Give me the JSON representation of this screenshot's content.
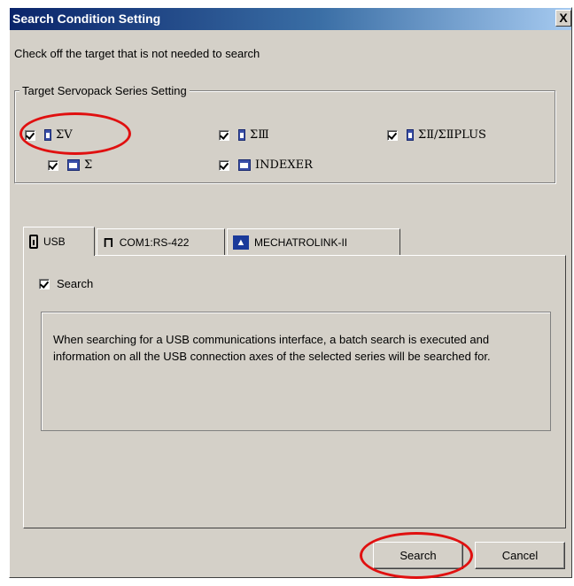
{
  "window": {
    "title": "Search Condition Setting",
    "close_label": "X"
  },
  "instruction": "Check off the target that is not needed to search",
  "series_group": {
    "legend": "Target Servopack Series Setting",
    "items": [
      {
        "label": "ΣV",
        "checked": true
      },
      {
        "label": "ΣⅢ",
        "checked": true
      },
      {
        "label": "ΣⅡ/ΣⅡPLUS",
        "checked": true
      },
      {
        "label": "Σ",
        "checked": true
      },
      {
        "label": "INDEXER",
        "checked": true
      }
    ]
  },
  "tabs": [
    {
      "label": "USB",
      "icon": "usb-icon",
      "active": true
    },
    {
      "label": "COM1:RS-422",
      "icon": "serial-port-icon",
      "active": false
    },
    {
      "label": "MECHATROLINK-II",
      "icon": "mechatrolink-icon",
      "active": false
    }
  ],
  "usb_panel": {
    "search_checkbox_label": "Search",
    "search_checked": true,
    "info_text": "When searching for a USB communications interface, a batch search is executed and information on all the USB connection axes of the selected series will be searched for."
  },
  "buttons": {
    "search": "Search",
    "cancel": "Cancel"
  },
  "colors": {
    "highlight_ellipse": "#e01010",
    "title_bar": "#0a246a",
    "dialog_bg": "#d4d0c8"
  }
}
